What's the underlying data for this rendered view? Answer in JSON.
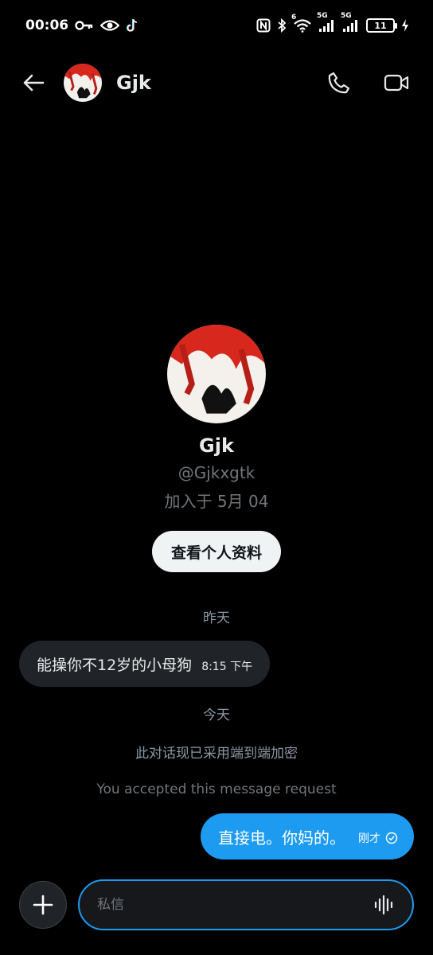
{
  "status_bar": {
    "time": "00:06",
    "network_1": "5G",
    "network_2": "5G",
    "wifi_badge": "6",
    "battery": "11"
  },
  "header": {
    "title": "Gjk"
  },
  "profile": {
    "name": "Gjk",
    "handle": "@Gjkxgtk",
    "joined": "加入于 5月 04",
    "view_profile_label": "查看个人资料"
  },
  "conversation": {
    "day_yesterday": "昨天",
    "incoming": {
      "text": "能操你不12岁的小母狗",
      "time": "8:15 下午"
    },
    "day_today": "今天",
    "encryption_notice": "此对话现已采用端到端加密",
    "request_notice": "You accepted this message request",
    "outgoing": {
      "text": "直接电。你妈的。",
      "time": "刚才"
    }
  },
  "composer": {
    "placeholder": "私信"
  },
  "colors": {
    "accent": "#1d9bf0",
    "background": "#000000",
    "bubble_in": "#202327"
  }
}
